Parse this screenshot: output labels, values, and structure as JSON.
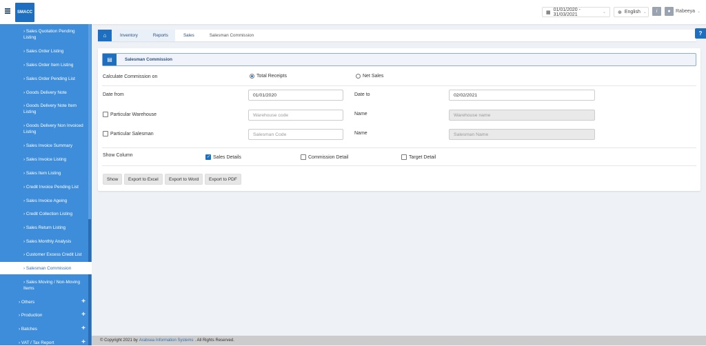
{
  "header": {
    "logo": "SMACC",
    "date_range": "01/01/2020 - 31/03/2021",
    "language": "English",
    "info": "i",
    "user": "Rabeeya"
  },
  "sidebar": {
    "items": [
      {
        "label": "› Sales Quotation Pending Listing"
      },
      {
        "label": "› Sales Order Listing"
      },
      {
        "label": "› Sales Order Item Listing"
      },
      {
        "label": "› Sales Order Pending List"
      },
      {
        "label": "› Goods Delivery Note"
      },
      {
        "label": "› Goods Delivery Note Item Listing"
      },
      {
        "label": "› Goods Delivery Non Invoiced Listing"
      },
      {
        "label": "› Sales Invoice Summary"
      },
      {
        "label": "› Sales Invoice Listing"
      },
      {
        "label": "› Sales Item Listing"
      },
      {
        "label": "› Credit Invoice Pending List"
      },
      {
        "label": "› Sales Invoice Ageing"
      },
      {
        "label": "› Credit Collection Listing"
      },
      {
        "label": "› Sales Return Listing"
      },
      {
        "label": "› Sales Monthly Analysis"
      },
      {
        "label": "› Customer Excess Credit List"
      },
      {
        "label": "› Salesman Commission"
      },
      {
        "label": "› Sales Moving / Non-Moving Items"
      }
    ],
    "groups": [
      {
        "label": "› Others"
      },
      {
        "label": "› Production"
      },
      {
        "label": "› Batches"
      },
      {
        "label": "› VAT / Tax Report"
      }
    ]
  },
  "breadcrumb": [
    "Inventory",
    "Reports",
    "Sales",
    "Salesman Commission"
  ],
  "form": {
    "title": "Salesman Commission",
    "calc_label": "Calculate Commission on",
    "opt_total": "Total Receipts",
    "opt_net": "Net Sales",
    "date_from_label": "Date from",
    "date_from": "01/01/2020",
    "date_to_label": "Date to",
    "date_to": "02/02/2021",
    "warehouse_label": "Particular Warehouse",
    "warehouse_ph": "Warehouse code",
    "name_label": "Name",
    "warehouse_name_ph": "Warehouse name",
    "salesman_label": "Particular Salesman",
    "salesman_ph": "Salesman Code",
    "salesman_name_ph": "Salesman Name",
    "show_column_label": "Show Column",
    "sales_details": "Sales Details",
    "commission_detail": "Commission Detail",
    "target_detail": "Target Detail",
    "buttons": [
      "Show",
      "Export to Excel",
      "Export to Word",
      "Export to PDF"
    ]
  },
  "footer": {
    "prefix": "© Copyright 2021 by",
    "company": "Arabsea Information Systems",
    "suffix": ". All Rights Reserved."
  }
}
